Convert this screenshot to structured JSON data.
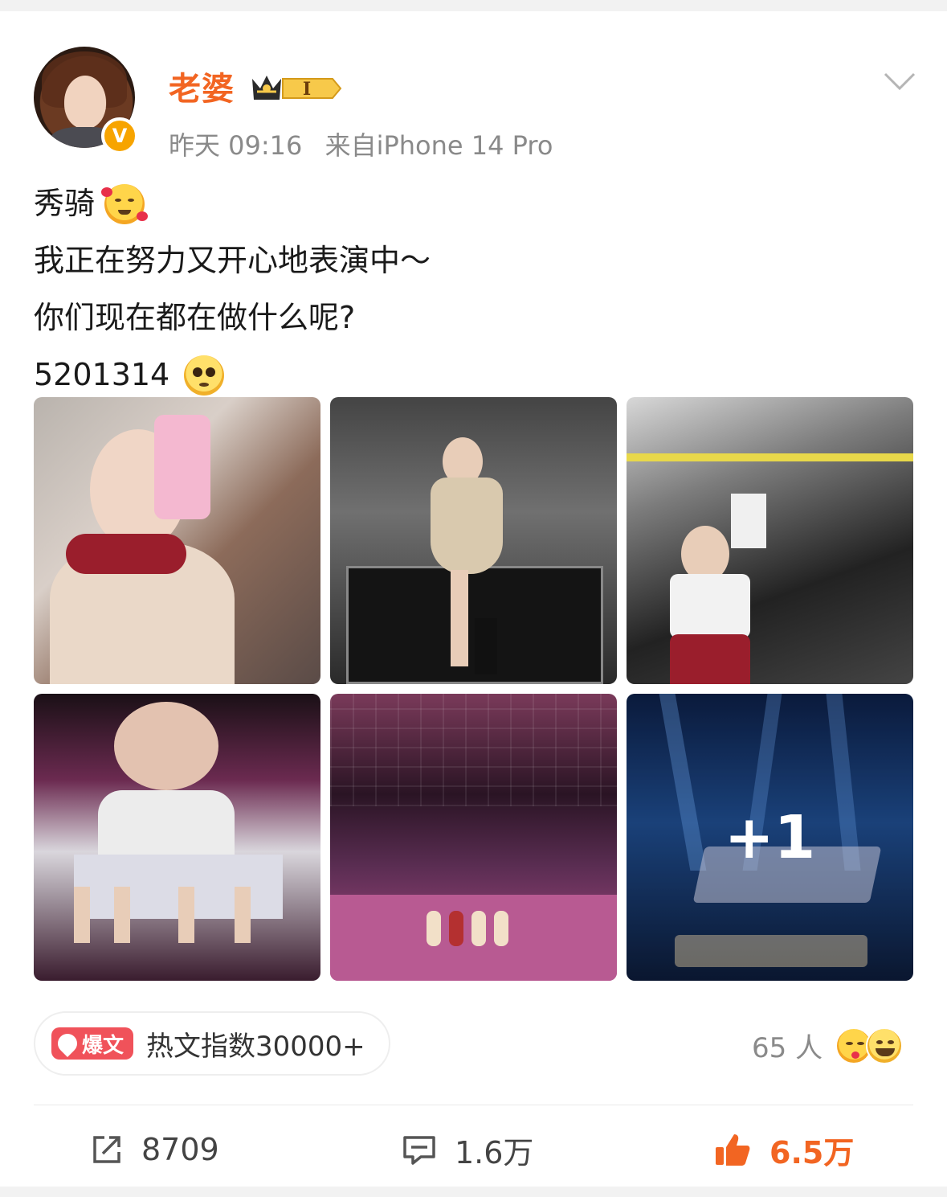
{
  "post": {
    "author": "老婆",
    "verify_badge": "V",
    "vip_level": "I",
    "time": "昨天 09:16",
    "source": "来自iPhone 14 Pro",
    "content_lines": [
      "秀骑",
      "我正在努力又开心地表演中～",
      "你们现在都在做什么呢?",
      "5201314"
    ],
    "images_more_label": "+1"
  },
  "hot": {
    "badge": "爆文",
    "text": "热文指数30000+"
  },
  "reactions": {
    "count_label": "65 人"
  },
  "actions": {
    "share": "8709",
    "comment": "1.6万",
    "like": "6.5万"
  },
  "colors": {
    "accent": "#f26522",
    "hot_badge": "#f0525a",
    "verify": "#f7a400",
    "muted": "#8a8a8a"
  }
}
